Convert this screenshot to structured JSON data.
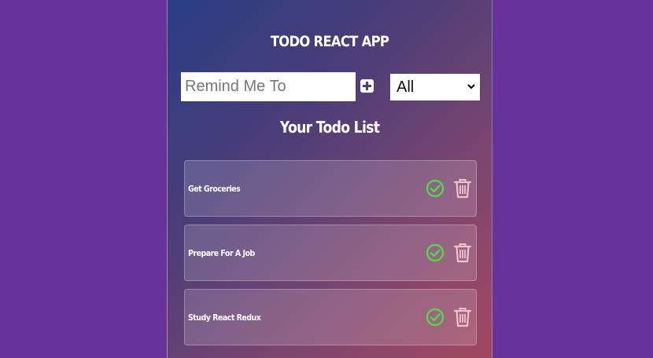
{
  "app": {
    "title": "TODO REACT APP"
  },
  "form": {
    "input_placeholder": "Remind Me To",
    "input_value": "",
    "add_icon": "plus-square-icon",
    "filter_selected": "All"
  },
  "list": {
    "title": "Your Todo List",
    "items": [
      {
        "text": "Get Groceries"
      },
      {
        "text": "Prepare For A Job"
      },
      {
        "text": "Study React Redux"
      }
    ]
  },
  "icons": {
    "complete": "check-circle-icon",
    "delete": "trash-icon"
  },
  "colors": {
    "page_background": "#66339a",
    "gradient_start": "#293e85",
    "gradient_end": "#a4485f",
    "check_green": "#52d94a",
    "trash_pink": "#f1c1cc"
  }
}
